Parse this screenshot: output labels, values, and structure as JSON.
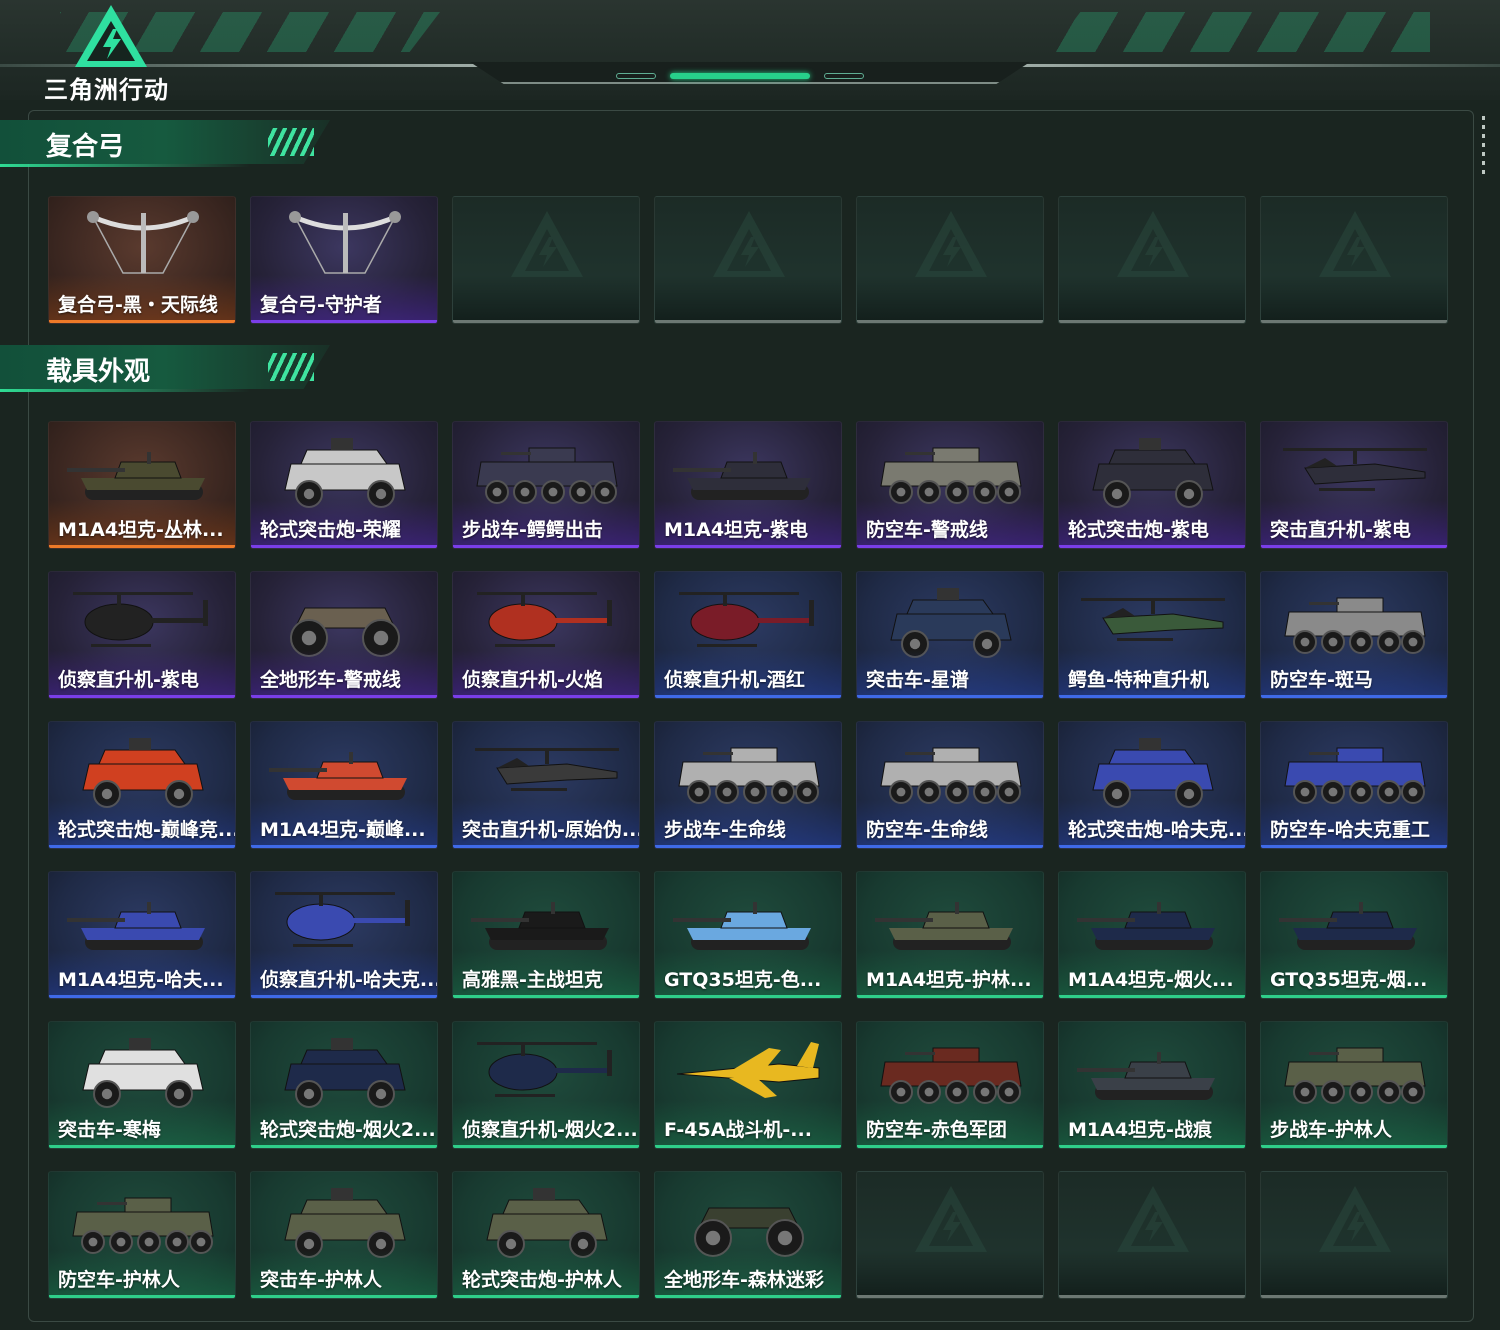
{
  "header": {
    "logo_text": "三角洲行动"
  },
  "sections": [
    {
      "title": "复合弓",
      "cards": [
        {
          "name": "复合弓-黑・天际线",
          "rarity": "orange",
          "icon": "bow-icon"
        },
        {
          "name": "复合弓-守护者",
          "rarity": "purple",
          "icon": "bow-icon"
        },
        {
          "name": "",
          "rarity": "empty",
          "icon": "placeholder-logo-icon"
        },
        {
          "name": "",
          "rarity": "empty",
          "icon": "placeholder-logo-icon"
        },
        {
          "name": "",
          "rarity": "empty",
          "icon": "placeholder-logo-icon"
        },
        {
          "name": "",
          "rarity": "empty",
          "icon": "placeholder-logo-icon"
        },
        {
          "name": "",
          "rarity": "empty",
          "icon": "placeholder-logo-icon"
        }
      ]
    },
    {
      "title": "载具外观",
      "cards": [
        {
          "name": "M1A4坦克-丛林...",
          "rarity": "orange",
          "icon": "tank-icon",
          "color": "#4a4a30"
        },
        {
          "name": "轮式突击炮-荣耀",
          "rarity": "purple",
          "icon": "armored-car-icon",
          "color": "#c8c8c8"
        },
        {
          "name": "步战车-鳄鳄出击",
          "rarity": "purple",
          "icon": "apc-icon",
          "color": "#3a3a50"
        },
        {
          "name": "M1A4坦克-紫电",
          "rarity": "purple",
          "icon": "tank-icon",
          "color": "#2e2e3a"
        },
        {
          "name": "防空车-警戒线",
          "rarity": "purple",
          "icon": "apc-icon",
          "color": "#7a7a70"
        },
        {
          "name": "轮式突击炮-紫电",
          "rarity": "purple",
          "icon": "armored-car-icon",
          "color": "#2e2e3a"
        },
        {
          "name": "突击直升机-紫电",
          "rarity": "purple",
          "icon": "helicopter-icon",
          "color": "#2e2e3a"
        },
        {
          "name": "侦察直升机-紫电",
          "rarity": "purple",
          "icon": "light-helicopter-icon",
          "color": "#222"
        },
        {
          "name": "全地形车-警戒线",
          "rarity": "purple",
          "icon": "atv-icon",
          "color": "#6a6050"
        },
        {
          "name": "侦察直升机-火焰",
          "rarity": "purple",
          "icon": "light-helicopter-icon",
          "color": "#b03020"
        },
        {
          "name": "侦察直升机-酒红",
          "rarity": "blue",
          "icon": "light-helicopter-icon",
          "color": "#7a1c28"
        },
        {
          "name": "突击车-星谱",
          "rarity": "blue",
          "icon": "armored-car-icon",
          "color": "#2a3a5a"
        },
        {
          "name": "鳄鱼-特种直升机",
          "rarity": "blue",
          "icon": "helicopter-icon",
          "color": "#3a5a3a"
        },
        {
          "name": "防空车-斑马",
          "rarity": "blue",
          "icon": "apc-icon",
          "color": "#8a8a8a"
        },
        {
          "name": "轮式突击炮-巅峰竞...",
          "rarity": "blue",
          "icon": "armored-car-icon",
          "color": "#d04020"
        },
        {
          "name": "M1A4坦克-巅峰...",
          "rarity": "blue",
          "icon": "tank-icon",
          "color": "#d04a30"
        },
        {
          "name": "突击直升机-原始伪...",
          "rarity": "blue",
          "icon": "helicopter-icon",
          "color": "#3a3a3a"
        },
        {
          "name": "步战车-生命线",
          "rarity": "blue",
          "icon": "apc-icon",
          "color": "#b0b0b0"
        },
        {
          "name": "防空车-生命线",
          "rarity": "blue",
          "icon": "apc-icon",
          "color": "#b0b0b0"
        },
        {
          "name": "轮式突击炮-哈夫克...",
          "rarity": "blue",
          "icon": "armored-car-icon",
          "color": "#3a4ab0"
        },
        {
          "name": "防空车-哈夫克重工",
          "rarity": "blue",
          "icon": "apc-icon",
          "color": "#3a4ab0"
        },
        {
          "name": "M1A4坦克-哈夫...",
          "rarity": "blue",
          "icon": "tank-icon",
          "color": "#3a4ab0"
        },
        {
          "name": "侦察直升机-哈夫克...",
          "rarity": "blue",
          "icon": "light-helicopter-icon",
          "color": "#3a4ab0"
        },
        {
          "name": "高雅黑-主战坦克",
          "rarity": "green",
          "icon": "tank-icon",
          "color": "#1a1a1a"
        },
        {
          "name": "GTQ35坦克-色...",
          "rarity": "green",
          "icon": "tank-icon",
          "color": "#6aa8e0"
        },
        {
          "name": "M1A4坦克-护林...",
          "rarity": "green",
          "icon": "tank-icon",
          "color": "#5a6048"
        },
        {
          "name": "M1A4坦克-烟火...",
          "rarity": "green",
          "icon": "tank-icon",
          "color": "#1e2a4a"
        },
        {
          "name": "GTQ35坦克-烟...",
          "rarity": "green",
          "icon": "tank-icon",
          "color": "#1e2a4a"
        },
        {
          "name": "突击车-寒梅",
          "rarity": "green",
          "icon": "armored-car-icon",
          "color": "#e0e0e0"
        },
        {
          "name": "轮式突击炮-烟火2...",
          "rarity": "green",
          "icon": "armored-car-icon",
          "color": "#1e2a4a"
        },
        {
          "name": "侦察直升机-烟火2...",
          "rarity": "green",
          "icon": "light-helicopter-icon",
          "color": "#1e2a4a"
        },
        {
          "name": "F-45A战斗机-...",
          "rarity": "green",
          "icon": "jet-icon",
          "color": "#e8b820"
        },
        {
          "name": "防空车-赤色军团",
          "rarity": "green",
          "icon": "apc-icon",
          "color": "#6a2a20"
        },
        {
          "name": "M1A4坦克-战痕",
          "rarity": "green",
          "icon": "tank-icon",
          "color": "#3a4048"
        },
        {
          "name": "步战车-护林人",
          "rarity": "green",
          "icon": "apc-icon",
          "color": "#5a6048"
        },
        {
          "name": "防空车-护林人",
          "rarity": "green",
          "icon": "apc-icon",
          "color": "#5a6048"
        },
        {
          "name": "突击车-护林人",
          "rarity": "green",
          "icon": "armored-car-icon",
          "color": "#5a6048"
        },
        {
          "name": "轮式突击炮-护林人",
          "rarity": "green",
          "icon": "armored-car-icon",
          "color": "#5a6048"
        },
        {
          "name": "全地形车-森林迷彩",
          "rarity": "green",
          "icon": "atv-icon",
          "color": "#3a4030"
        },
        {
          "name": "",
          "rarity": "empty",
          "icon": "placeholder-logo-icon"
        },
        {
          "name": "",
          "rarity": "empty",
          "icon": "placeholder-logo-icon"
        },
        {
          "name": "",
          "rarity": "empty",
          "icon": "placeholder-logo-icon"
        }
      ]
    }
  ]
}
